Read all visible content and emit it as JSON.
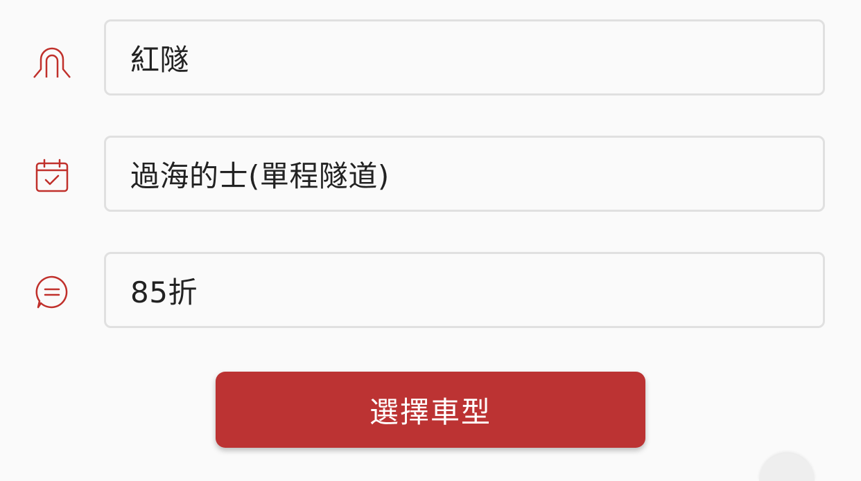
{
  "colors": {
    "accent": "#bc3333",
    "icon": "#c0302b",
    "field_border": "#e0e0e0",
    "text": "#222222",
    "background": "#fafafa"
  },
  "fields": [
    {
      "icon": "tunnel-icon",
      "value": "紅隧"
    },
    {
      "icon": "calendar-check-icon",
      "value": "過海的士(單程隧道)"
    },
    {
      "icon": "chat-bubble-icon",
      "value": "85折"
    }
  ],
  "submit": {
    "label": "選擇車型"
  }
}
